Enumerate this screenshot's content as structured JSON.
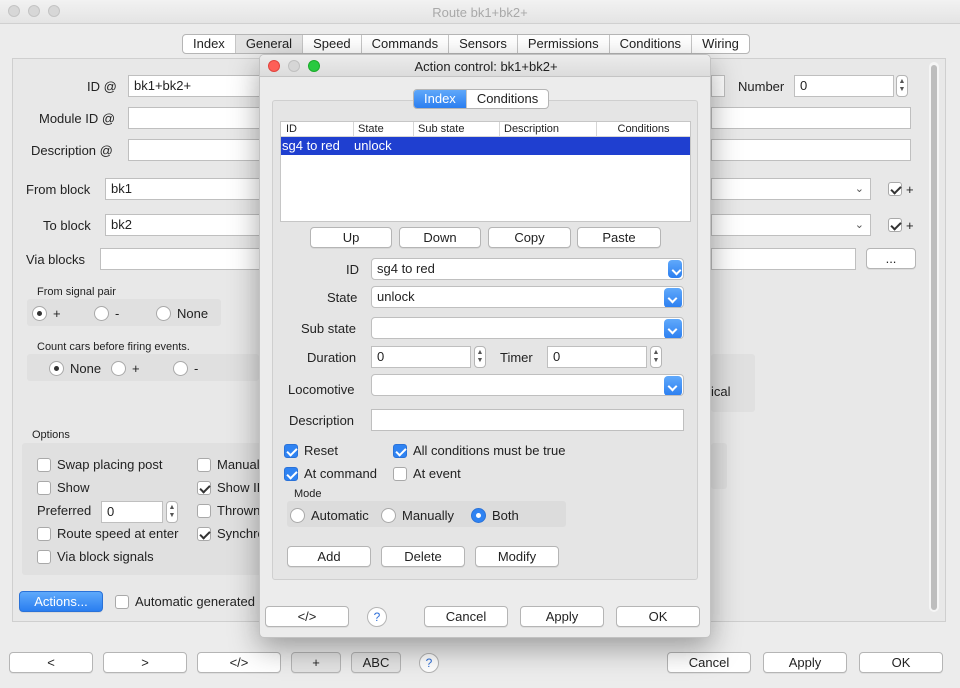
{
  "window": {
    "title": "Route bk1+bk2+"
  },
  "main_tabs": [
    "Index",
    "General",
    "Speed",
    "Commands",
    "Sensors",
    "Permissions",
    "Conditions",
    "Wiring"
  ],
  "general": {
    "id_label": "ID @",
    "id_value": "bk1+bk2+",
    "number_label": "Number",
    "number_value": "0",
    "module_label": "Module ID @",
    "description_label": "Description @",
    "from_block_label": "From block",
    "from_block_value": "bk1",
    "to_block_label": "To block",
    "to_block_value": "bk2",
    "via_blocks_label": "Via blocks",
    "via_button": "...",
    "plus_label": "+",
    "signal_pair_title": "From signal pair",
    "signal_options": [
      "+",
      "-",
      "None"
    ],
    "count_cars_title": "Count cars before firing events.",
    "count_options": [
      "None",
      "+",
      "-"
    ],
    "partial_right": "ical",
    "options_title": "Options",
    "opt_swap": "Swap placing post",
    "opt_show": "Show",
    "opt_preferred": "Preferred",
    "preferred_value": "0",
    "opt_route_speed": "Route speed at enter",
    "opt_via_signals": "Via block signals",
    "opt_manual": "Manual",
    "opt_show_id": "Show ID",
    "opt_thrown": "Thrown",
    "opt_synchro": "Synchro",
    "actions_button": "Actions...",
    "auto_generated": "Automatic generated"
  },
  "bottom": {
    "prev": "<",
    "next": ">",
    "xml": "</>",
    "plus": "+",
    "abc": "ABC",
    "help": "?",
    "cancel": "Cancel",
    "apply": "Apply",
    "ok": "OK"
  },
  "dialog": {
    "title": "Action control: bk1+bk2+",
    "tabs": [
      "Index",
      "Conditions"
    ],
    "table_headers": [
      "ID",
      "State",
      "Sub state",
      "Description",
      "Conditions"
    ],
    "rows": [
      {
        "id": "sg4 to red",
        "state": "unlock",
        "substate": "",
        "description": "",
        "conditions": ""
      }
    ],
    "btn_up": "Up",
    "btn_down": "Down",
    "btn_copy": "Copy",
    "btn_paste": "Paste",
    "id_label": "ID",
    "id_value": "sg4 to red",
    "state_label": "State",
    "state_value": "unlock",
    "substate_label": "Sub state",
    "substate_value": "",
    "duration_label": "Duration",
    "duration_value": "0",
    "timer_label": "Timer",
    "timer_value": "0",
    "loco_label": "Locomotive",
    "loco_value": "",
    "desc_label": "Description",
    "desc_value": "",
    "reset_label": "Reset",
    "all_cond_label": "All conditions must be true",
    "at_command_label": "At command",
    "at_event_label": "At event",
    "mode_title": "Mode",
    "mode_options": [
      "Automatic",
      "Manually",
      "Both"
    ],
    "btn_add": "Add",
    "btn_delete": "Delete",
    "btn_modify": "Modify",
    "btn_xml": "</>",
    "btn_help": "?",
    "btn_cancel": "Cancel",
    "btn_apply": "Apply",
    "btn_ok": "OK"
  },
  "colors": {
    "accent": "#2f83f2",
    "selection": "#1f3fd0"
  }
}
